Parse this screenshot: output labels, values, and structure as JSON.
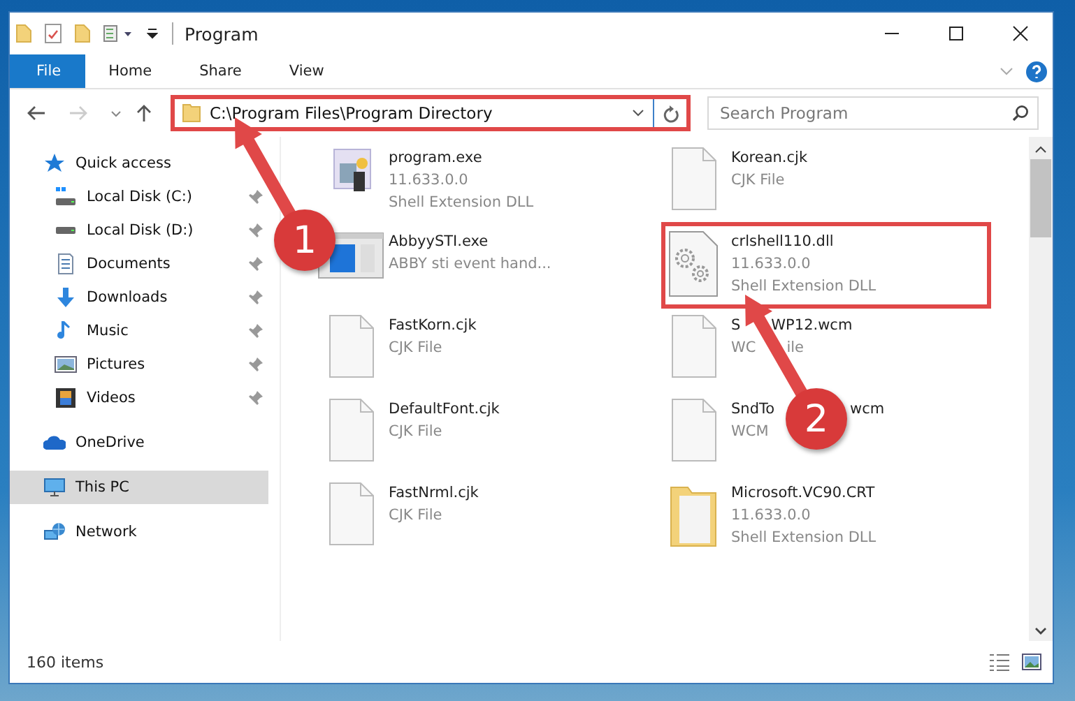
{
  "window": {
    "title": "Program"
  },
  "ribbon": {
    "tabs": [
      {
        "label": "File",
        "selected": true
      },
      {
        "label": "Home",
        "selected": false
      },
      {
        "label": "Share",
        "selected": false
      },
      {
        "label": "View",
        "selected": false
      }
    ]
  },
  "address_bar": {
    "path": "C:\\Program Files\\Program Directory",
    "highlighted": true
  },
  "search": {
    "placeholder": "Search Program"
  },
  "sidebar": {
    "items": [
      {
        "label": "Quick access",
        "kind": "quick",
        "selected": false,
        "children": [
          {
            "label": "Local Disk (C:)",
            "kind": "disk-c",
            "pinned": true,
            "selected": false
          },
          {
            "label": "Local Disk (D:)",
            "kind": "disk",
            "pinned": true,
            "selected": false
          },
          {
            "label": "Documents",
            "kind": "documents",
            "pinned": true,
            "selected": false
          },
          {
            "label": "Downloads",
            "kind": "downloads",
            "pinned": true,
            "selected": false
          },
          {
            "label": "Music",
            "kind": "music",
            "pinned": true,
            "selected": false
          },
          {
            "label": "Pictures",
            "kind": "pictures",
            "pinned": true,
            "selected": false
          },
          {
            "label": "Videos",
            "kind": "videos",
            "pinned": true,
            "selected": false
          }
        ]
      },
      {
        "label": "OneDrive",
        "kind": "cloud",
        "selected": false
      },
      {
        "label": "This PC",
        "kind": "pc",
        "selected": true
      },
      {
        "label": "Network",
        "kind": "network",
        "selected": false
      }
    ]
  },
  "files": [
    {
      "name": "program.exe",
      "details": [
        "11.633.0.0",
        "Shell Extension DLL"
      ],
      "kind": "app",
      "highlighted": false
    },
    {
      "name": "Korean.cjk",
      "details": [
        "CJK File"
      ],
      "kind": "blank",
      "highlighted": false
    },
    {
      "name": "AbbyySTI.exe",
      "details": [
        "ABBY sti event hand..."
      ],
      "kind": "window",
      "highlighted": false
    },
    {
      "name": "crlshell110.dll",
      "details": [
        "11.633.0.0",
        "Shell Extension DLL"
      ],
      "kind": "gears",
      "highlighted": true
    },
    {
      "name": "FastKorn.cjk",
      "details": [
        "CJK File"
      ],
      "kind": "blank",
      "highlighted": false
    },
    {
      "name": [
        "S",
        "WP12.wcm"
      ],
      "details": [
        [
          "WC",
          "ile"
        ]
      ],
      "kind": "blank",
      "highlighted": false
    },
    {
      "name": "DefaultFont.cjk",
      "details": [
        "CJK File"
      ],
      "kind": "blank",
      "highlighted": false
    },
    {
      "name": [
        "SndTo",
        "wcm"
      ],
      "details": [
        "WCM"
      ],
      "kind": "blank",
      "highlighted": false
    },
    {
      "name": "FastNrml.cjk",
      "details": [
        "CJK File"
      ],
      "kind": "blank",
      "highlighted": false
    },
    {
      "name": "Microsoft.VC90.CRT",
      "details": [
        "11.633.0.0",
        "Shell Extension DLL"
      ],
      "kind": "folder",
      "highlighted": false
    }
  ],
  "annotations": [
    {
      "number": "1"
    },
    {
      "number": "2"
    }
  ],
  "status_bar": {
    "count": "160 items"
  }
}
